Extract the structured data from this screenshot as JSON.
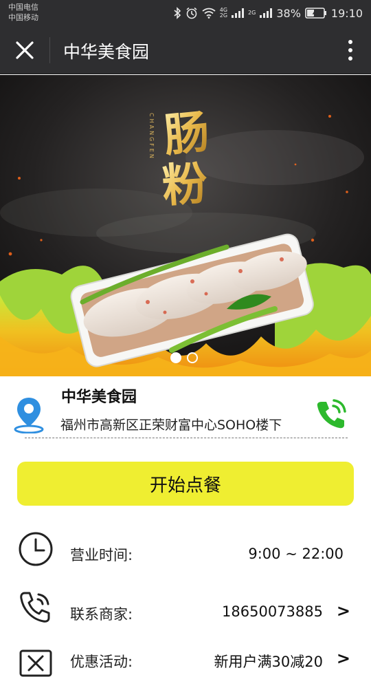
{
  "status_bar": {
    "carrier_1": "中国电信",
    "carrier_2": "中国移动",
    "network_1": "4G",
    "network_2": "2G",
    "battery": "38%",
    "time": "19:10"
  },
  "nav": {
    "title": "中华美食园"
  },
  "banner": {
    "calligraphy": "肠粉",
    "pinyin": "CHANGFEN",
    "slide_count": 2,
    "active_slide": 1
  },
  "shop": {
    "name": "中华美食园",
    "address": "福州市高新区正荣财富中心SOHO楼下"
  },
  "order_button": {
    "label": "开始点餐"
  },
  "info_rows": [
    {
      "label": "营业时间:",
      "value": "9:00 ~ 22:00",
      "icon": "clock-icon"
    },
    {
      "label": "联系商家:",
      "value": "18650073885",
      "icon": "phone-call-icon",
      "arrow": ">"
    },
    {
      "label": "优惠活动:",
      "value": "新用户满30减20",
      "icon": "coupon-icon",
      "arrow": ">"
    }
  ],
  "colors": {
    "nav_bg": "#2e2e30",
    "order_button": "#efee31",
    "location_blue": "#2f8fe0",
    "phone_green": "#2db92d"
  }
}
